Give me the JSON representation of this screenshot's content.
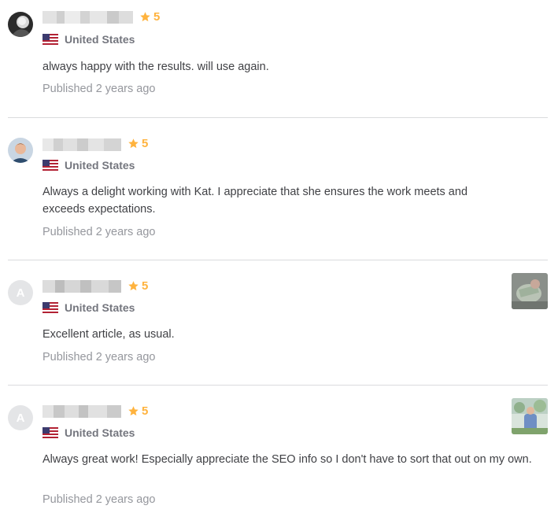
{
  "reviews": [
    {
      "rating": "5",
      "country": "United States",
      "comment": "always happy with the results. will use again.",
      "published": "Published 2 years ago",
      "avatar_letter": ""
    },
    {
      "rating": "5",
      "country": "United States",
      "comment": "Always a delight working with Kat. I appreciate that she ensures the work meets and exceeds expectations.",
      "published": "Published 2 years ago",
      "avatar_letter": ""
    },
    {
      "rating": "5",
      "country": "United States",
      "comment": "Excellent article, as usual.",
      "published": "Published 2 years ago",
      "avatar_letter": "A"
    },
    {
      "rating": "5",
      "country": "United States",
      "comment": "Always great work! Especially appreciate the SEO info so I don't have to sort that out on my own.",
      "published": "Published 2 years ago",
      "avatar_letter": "A"
    }
  ],
  "colors": {
    "star": "#ffb33e",
    "divider": "#dadbdd",
    "muted_text": "#95979d",
    "country_text": "#74767e"
  },
  "icons": {
    "star": "star-icon",
    "flag": "us-flag-icon"
  }
}
